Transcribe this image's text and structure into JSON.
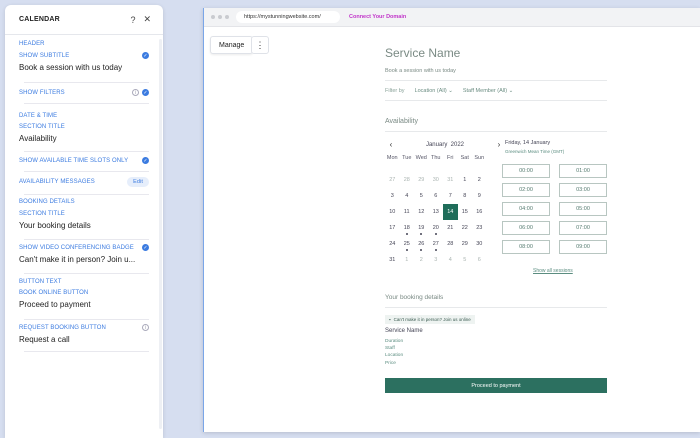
{
  "panel": {
    "title": "CALENDAR",
    "help_glyph": "?",
    "close_glyph": "✕",
    "sections": {
      "header": "HEADER",
      "date_time": "DATE & TIME",
      "booking_details": "BOOKING DETAILS",
      "button_text": "BUTTON TEXT"
    },
    "show_subtitle": {
      "label": "SHOW SUBTITLE",
      "value": "Book a session with us today",
      "checked": true
    },
    "show_filters": {
      "label": "SHOW FILTERS",
      "checked": true
    },
    "dt_section_title": {
      "label": "SECTION TITLE",
      "value": "Availability"
    },
    "show_available_slots": {
      "label": "SHOW AVAILABLE TIME SLOTS ONLY",
      "checked": true
    },
    "availability_messages": {
      "label": "AVAILABILITY MESSAGES",
      "button": "Edit"
    },
    "bd_section_title": {
      "label": "SECTION TITLE",
      "value": "Your booking details"
    },
    "video_badge": {
      "label": "SHOW VIDEO CONFERENCING BADGE",
      "value": "Can't make it in person? Join u...",
      "checked": true
    },
    "book_online_button": {
      "label": "BOOK ONLINE BUTTON",
      "value": "Proceed to payment"
    },
    "request_booking_button": {
      "label": "REQUEST BOOKING BUTTON",
      "value": "Request a call"
    }
  },
  "browser": {
    "url": "https://mystunningwebsite.com/",
    "connect_domain": "Connect Your Domain"
  },
  "toolbar": {
    "manage": "Manage",
    "more": "⋮"
  },
  "widget": {
    "service_name": "Service Name",
    "subtitle": "Book a session with us today",
    "filter_by": "Filter by",
    "location_filter": "Location (All)",
    "staff_filter": "Staff Member (All)",
    "availability_title": "Availability",
    "month": "January",
    "year": "2022",
    "prev": "‹",
    "next": "›",
    "weekdays": [
      "Mon",
      "Tue",
      "Wed",
      "Thu",
      "Fri",
      "Sat",
      "Sun"
    ],
    "days": [
      {
        "d": "27",
        "m": true
      },
      {
        "d": "28",
        "m": true
      },
      {
        "d": "29",
        "m": true
      },
      {
        "d": "30",
        "m": true
      },
      {
        "d": "31",
        "m": true
      },
      {
        "d": "1"
      },
      {
        "d": "2"
      },
      {
        "d": "3"
      },
      {
        "d": "4"
      },
      {
        "d": "5"
      },
      {
        "d": "6"
      },
      {
        "d": "7"
      },
      {
        "d": "8"
      },
      {
        "d": "9"
      },
      {
        "d": "10"
      },
      {
        "d": "11"
      },
      {
        "d": "12"
      },
      {
        "d": "13"
      },
      {
        "d": "14",
        "sel": true
      },
      {
        "d": "15"
      },
      {
        "d": "16"
      },
      {
        "d": "17"
      },
      {
        "d": "18",
        "dot": true
      },
      {
        "d": "19",
        "dot": true
      },
      {
        "d": "20",
        "dot": true
      },
      {
        "d": "21"
      },
      {
        "d": "22"
      },
      {
        "d": "23"
      },
      {
        "d": "24"
      },
      {
        "d": "25",
        "dot": true
      },
      {
        "d": "26",
        "dot": true
      },
      {
        "d": "27",
        "dot": true
      },
      {
        "d": "28"
      },
      {
        "d": "29"
      },
      {
        "d": "30"
      },
      {
        "d": "31"
      },
      {
        "d": "1",
        "m": true
      },
      {
        "d": "2",
        "m": true
      },
      {
        "d": "3",
        "m": true
      },
      {
        "d": "4",
        "m": true
      },
      {
        "d": "5",
        "m": true
      },
      {
        "d": "6",
        "m": true
      }
    ],
    "selected_date": "Friday, 14 January",
    "timezone": "Greenwich Mean Time (GMT)",
    "slots": [
      "00:00",
      "01:00",
      "02:00",
      "03:00",
      "04:00",
      "05:00",
      "06:00",
      "07:00",
      "08:00",
      "09:00"
    ],
    "show_all": "Show all sessions",
    "booking_title": "Your booking details",
    "badge_text": "Can't make it in person? Join us online",
    "bk_service": "Service Name",
    "bk_fields": [
      "Duration",
      "Staff",
      "Location",
      "Price"
    ],
    "proceed": "Proceed to payment"
  },
  "colors": {
    "accent": "#3b7be0",
    "brand_green": "#2c7060",
    "connect": "#c134c9"
  }
}
